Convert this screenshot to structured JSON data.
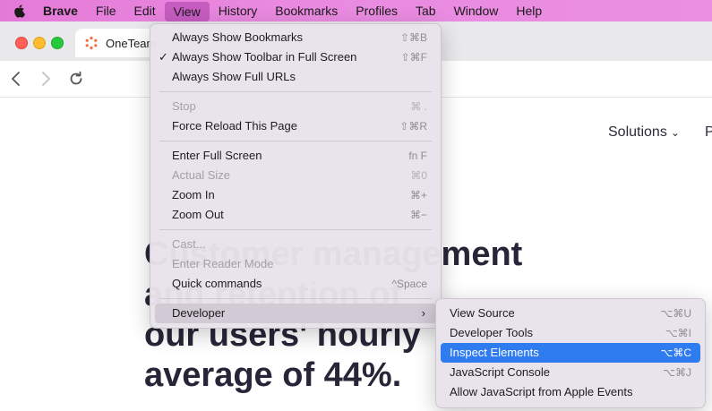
{
  "menubar": {
    "app_name": "Brave",
    "items": [
      "File",
      "Edit",
      "View",
      "History",
      "Bookmarks",
      "Profiles",
      "Tab",
      "Window",
      "Help"
    ],
    "active": "View"
  },
  "browser": {
    "tab_title": "OneTeam",
    "accent_color": "#e47ad8"
  },
  "page": {
    "nav_solutions": "Solutions",
    "nav_partial": "P",
    "headline_lines": [
      "Customer management",
      "and retention of",
      "our users' hourly",
      "average of 44%."
    ]
  },
  "view_menu": {
    "items": [
      {
        "label": "Always Show Bookmarks",
        "shortcut": "⇧⌘B",
        "disabled": false,
        "checked": false
      },
      {
        "label": "Always Show Toolbar in Full Screen",
        "shortcut": "⇧⌘F",
        "disabled": false,
        "checked": true
      },
      {
        "label": "Always Show Full URLs",
        "shortcut": "",
        "disabled": false,
        "checked": false
      },
      {
        "label": "Stop",
        "shortcut": "⌘ .",
        "disabled": true,
        "checked": false
      },
      {
        "label": "Force Reload This Page",
        "shortcut": "⇧⌘R",
        "disabled": false,
        "checked": false
      },
      {
        "label": "Enter Full Screen",
        "shortcut": "fn F",
        "disabled": false,
        "checked": false
      },
      {
        "label": "Actual Size",
        "shortcut": "⌘0",
        "disabled": true,
        "checked": false
      },
      {
        "label": "Zoom In",
        "shortcut": "⌘+",
        "disabled": false,
        "checked": false
      },
      {
        "label": "Zoom Out",
        "shortcut": "⌘−",
        "disabled": false,
        "checked": false
      },
      {
        "label": "Cast...",
        "shortcut": "",
        "disabled": true,
        "checked": false
      },
      {
        "label": "Enter Reader Mode",
        "shortcut": "",
        "disabled": true,
        "checked": false
      },
      {
        "label": "Quick commands",
        "shortcut": "^Space",
        "disabled": false,
        "checked": false
      },
      {
        "label": "Developer",
        "shortcut": "",
        "disabled": false,
        "checked": false,
        "submenu": true
      }
    ]
  },
  "developer_menu": {
    "items": [
      {
        "label": "View Source",
        "shortcut": "⌥⌘U"
      },
      {
        "label": "Developer Tools",
        "shortcut": "⌥⌘I"
      },
      {
        "label": "Inspect Elements",
        "shortcut": "⌥⌘C",
        "highlighted": true
      },
      {
        "label": "JavaScript Console",
        "shortcut": "⌥⌘J"
      },
      {
        "label": "Allow JavaScript from Apple Events",
        "shortcut": ""
      }
    ],
    "highlight_color": "#2f7bf0"
  }
}
